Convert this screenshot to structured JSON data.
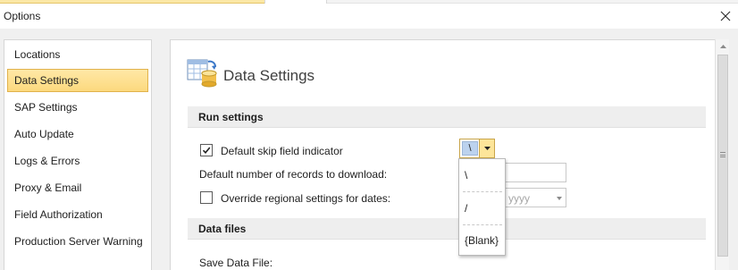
{
  "window": {
    "title": "Options"
  },
  "sidebar": {
    "items": [
      {
        "label": "Locations"
      },
      {
        "label": "Data Settings",
        "selected": true
      },
      {
        "label": "SAP Settings"
      },
      {
        "label": "Auto Update"
      },
      {
        "label": "Logs & Errors"
      },
      {
        "label": "Proxy & Email"
      },
      {
        "label": "Field Authorization"
      },
      {
        "label": "Production Server Warning"
      }
    ]
  },
  "page": {
    "title": "Data Settings",
    "icon": "data-settings-icon"
  },
  "run_settings": {
    "header": "Run settings",
    "skip_field": {
      "label": "Default skip field indicator",
      "checked": true,
      "value": "\\"
    },
    "records": {
      "label": "Default number of records to download:",
      "value": ""
    },
    "override_dates": {
      "label": "Override regional settings for dates:",
      "checked": false,
      "placeholder": "yyyy"
    }
  },
  "skip_dropdown": {
    "options": [
      "\\",
      "/",
      "{Blank}"
    ]
  },
  "data_files": {
    "header": "Data files",
    "save_label": "Save Data File:"
  },
  "colors": {
    "selected_bg": "#fcd97e",
    "selected_border": "#e1b24c",
    "section_bg": "#eeeeee",
    "dialog_bg": "#f0f0f0"
  }
}
